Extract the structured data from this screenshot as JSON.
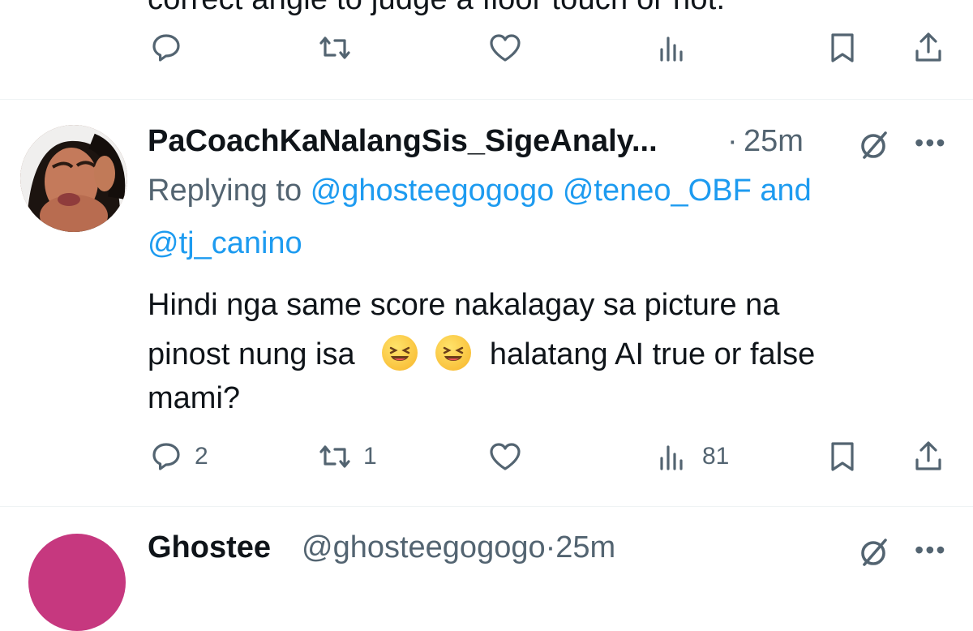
{
  "top_tweet": {
    "text_cut": "correct angle to judge a floor touch or not.",
    "actions": {
      "reply_count": "",
      "retweet_count": "",
      "like_count": "",
      "views_count": ""
    }
  },
  "tweet": {
    "display_name": "PaCoachKaNalangSis_SigeAnaly...",
    "separator": "·",
    "time": "25m",
    "replying_prefix": "Replying to",
    "mention_1": "@ghosteegogogo",
    "mention_2": "@teneo_OBF",
    "and_word": "and",
    "mention_3": "@tj_canino",
    "body_line_1": "Hindi nga same score nakalagay sa picture na",
    "body_line_2_start": "pinost nung isa",
    "body_line_2_end": "halatang AI true or false",
    "body_line_3": "mami?",
    "emoji_1": "😆",
    "emoji_2": "😆",
    "more_label": "•••",
    "actions": {
      "reply_count": "2",
      "retweet_count": "1",
      "like_count": "",
      "views_count": "81"
    }
  },
  "next_tweet": {
    "display_name": "Ghostee",
    "handle": "@ghosteegogogo",
    "separator": "·",
    "time": "25m",
    "more_label": "•••"
  },
  "icons": [
    "reply-icon",
    "retweet-icon",
    "like-icon",
    "views-icon",
    "bookmark-icon",
    "share-icon",
    "grok-icon",
    "more-icon"
  ],
  "colors": {
    "text": "#0f1419",
    "muted": "#536471",
    "link": "#1d9bf0",
    "divider": "#eff3f4",
    "next_avatar": "#c6387f"
  }
}
